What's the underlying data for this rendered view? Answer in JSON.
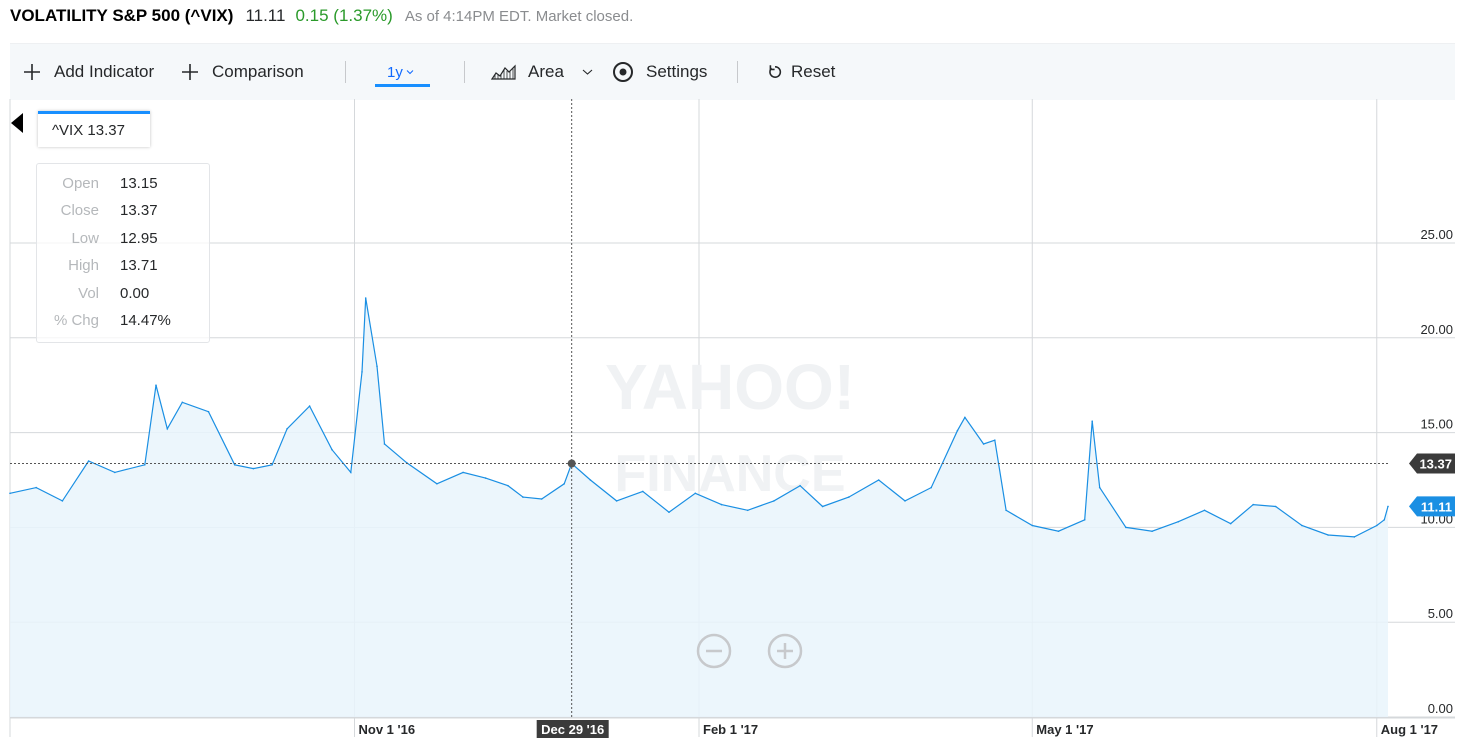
{
  "header": {
    "name": "VOLATILITY S&P 500 (^VIX)",
    "price": "11.11",
    "change": "0.15 (1.37%)",
    "as_of": "As of 4:14PM EDT. Market closed."
  },
  "toolbar": {
    "add_indicator": "Add Indicator",
    "comparison": "Comparison",
    "range": "1y",
    "chart_type": "Area",
    "settings": "Settings",
    "reset": "Reset"
  },
  "tag": {
    "label": "^VIX 13.37"
  },
  "ohlc": {
    "open_label": "Open",
    "open": "13.15",
    "close_label": "Close",
    "close": "13.37",
    "low_label": "Low",
    "low": "12.95",
    "high_label": "High",
    "high": "13.71",
    "vol_label": "Vol",
    "vol": "0.00",
    "chg_label": "% Chg",
    "chg": "14.47%"
  },
  "colors": {
    "line": "#1a8fe3",
    "area": "#e9f4fc",
    "grid": "#d5d8db",
    "positive": "#2a9a2a",
    "accent": "#188fff",
    "price_tag": "#1a8fe3",
    "crosshair_tag": "#3b3b3b"
  },
  "icons": {
    "add_indicator": "plus-icon",
    "comparison": "plus-icon",
    "area": "area-chart-icon",
    "settings": "gear-icon",
    "reset": "reset-icon",
    "zoom_out": "minus-circle-icon",
    "zoom_in": "plus-circle-icon"
  },
  "chart_data": {
    "type": "area",
    "title": "",
    "xlabel": "",
    "ylabel": "",
    "ylim": [
      0,
      25
    ],
    "yticks": [
      "25.00",
      "20.00",
      "15.00",
      "10.00",
      "5.00",
      "0.00"
    ],
    "x_ticks": [
      "Nov 1 '16",
      "Dec 29 '16",
      "Feb 1 '17",
      "May 1 '17",
      "Aug 1 '17"
    ],
    "x_range": [
      "2016-08-01",
      "2017-08-04"
    ],
    "grid": true,
    "crosshair": {
      "date": "2016-12-29",
      "label": "Dec 29 '16",
      "value": 13.37,
      "value_label": "13.37"
    },
    "last": {
      "value": 11.11,
      "label": "11.11"
    },
    "watermark": [
      "YAHOO!",
      "FINANCE"
    ],
    "series": [
      {
        "values": [
          [
            "2016-08-01",
            11.8
          ],
          [
            "2016-08-08",
            12.1
          ],
          [
            "2016-08-15",
            11.4
          ],
          [
            "2016-08-22",
            13.5
          ],
          [
            "2016-08-29",
            12.9
          ],
          [
            "2016-09-06",
            13.3
          ],
          [
            "2016-09-09",
            17.5
          ],
          [
            "2016-09-12",
            15.2
          ],
          [
            "2016-09-16",
            16.6
          ],
          [
            "2016-09-23",
            16.1
          ],
          [
            "2016-09-30",
            13.3
          ],
          [
            "2016-10-05",
            13.1
          ],
          [
            "2016-10-10",
            13.3
          ],
          [
            "2016-10-14",
            15.2
          ],
          [
            "2016-10-20",
            16.4
          ],
          [
            "2016-10-26",
            14.1
          ],
          [
            "2016-10-31",
            12.9
          ],
          [
            "2016-11-03",
            18.2
          ],
          [
            "2016-11-04",
            22.1
          ],
          [
            "2016-11-07",
            18.5
          ],
          [
            "2016-11-09",
            14.4
          ],
          [
            "2016-11-15",
            13.4
          ],
          [
            "2016-11-23",
            12.3
          ],
          [
            "2016-11-30",
            12.9
          ],
          [
            "2016-12-06",
            12.6
          ],
          [
            "2016-12-12",
            12.2
          ],
          [
            "2016-12-16",
            11.6
          ],
          [
            "2016-12-21",
            11.5
          ],
          [
            "2016-12-27",
            12.3
          ],
          [
            "2016-12-29",
            13.37
          ],
          [
            "2017-01-03",
            12.5
          ],
          [
            "2017-01-10",
            11.4
          ],
          [
            "2017-01-17",
            11.9
          ],
          [
            "2017-01-24",
            10.8
          ],
          [
            "2017-01-31",
            11.8
          ],
          [
            "2017-02-07",
            11.2
          ],
          [
            "2017-02-14",
            10.9
          ],
          [
            "2017-02-21",
            11.4
          ],
          [
            "2017-02-28",
            12.2
          ],
          [
            "2017-03-06",
            11.1
          ],
          [
            "2017-03-13",
            11.6
          ],
          [
            "2017-03-21",
            12.5
          ],
          [
            "2017-03-28",
            11.4
          ],
          [
            "2017-04-04",
            12.1
          ],
          [
            "2017-04-11",
            15.1
          ],
          [
            "2017-04-13",
            15.8
          ],
          [
            "2017-04-18",
            14.4
          ],
          [
            "2017-04-21",
            14.6
          ],
          [
            "2017-04-24",
            10.9
          ],
          [
            "2017-05-01",
            10.1
          ],
          [
            "2017-05-08",
            9.8
          ],
          [
            "2017-05-15",
            10.4
          ],
          [
            "2017-05-17",
            15.6
          ],
          [
            "2017-05-19",
            12.1
          ],
          [
            "2017-05-26",
            10.0
          ],
          [
            "2017-06-02",
            9.8
          ],
          [
            "2017-06-09",
            10.3
          ],
          [
            "2017-06-16",
            10.9
          ],
          [
            "2017-06-23",
            10.2
          ],
          [
            "2017-06-29",
            11.2
          ],
          [
            "2017-07-05",
            11.1
          ],
          [
            "2017-07-12",
            10.1
          ],
          [
            "2017-07-19",
            9.6
          ],
          [
            "2017-07-26",
            9.5
          ],
          [
            "2017-08-01",
            10.1
          ],
          [
            "2017-08-03",
            10.4
          ],
          [
            "2017-08-04",
            11.11
          ]
        ]
      }
    ]
  }
}
